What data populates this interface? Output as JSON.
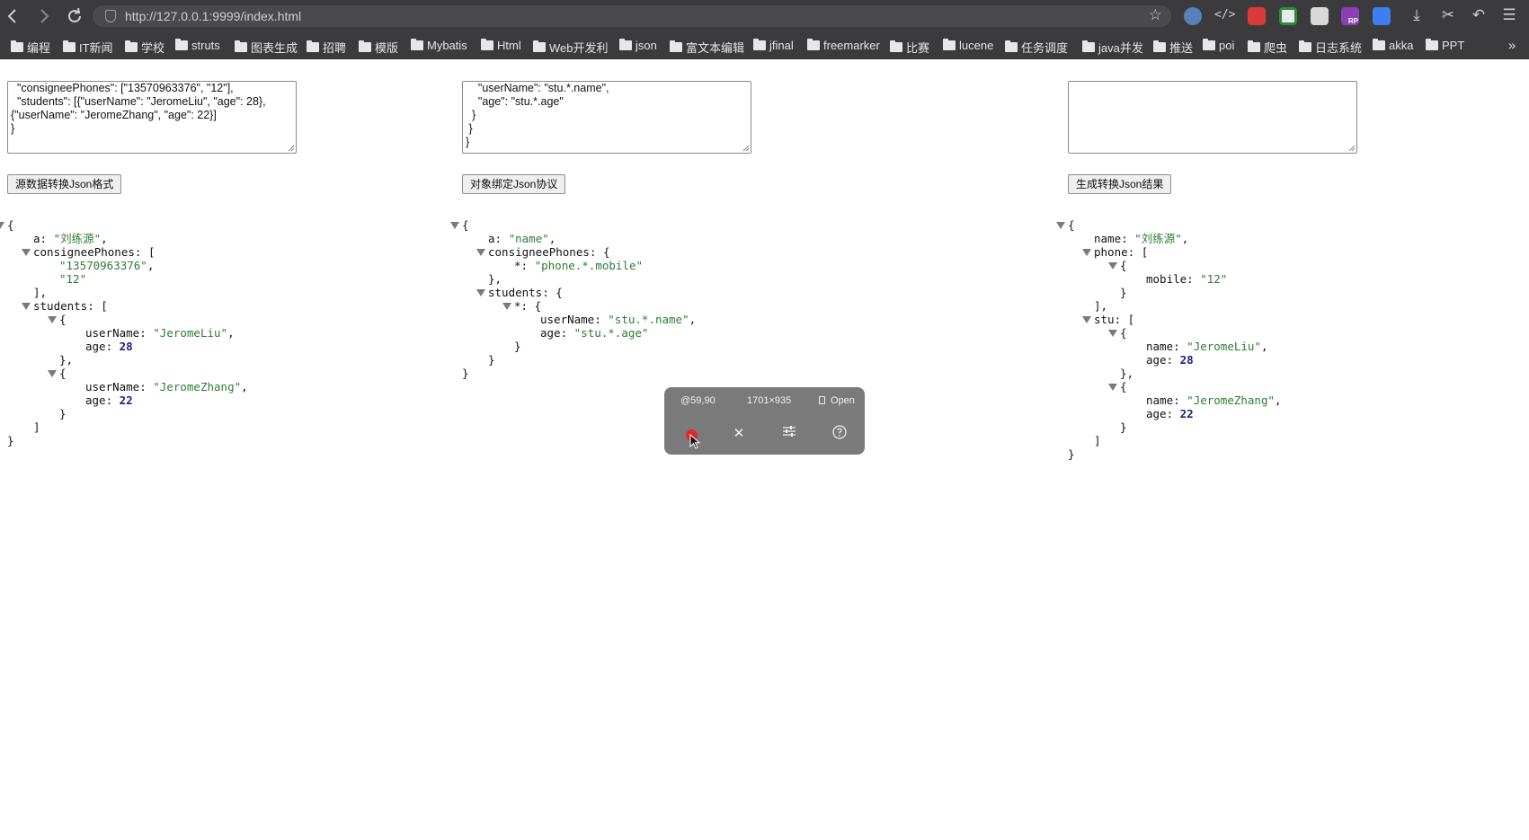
{
  "browser": {
    "url": "http://127.0.0.1:9999/index.html",
    "icons": [
      "back-icon",
      "forward-icon",
      "reload-icon",
      "shield-icon",
      "bookmark-star-icon"
    ],
    "extensions": [
      "translate-icon",
      "code-icon",
      "extension-red-icon",
      "extension-green-icon",
      "extension-gray-icon",
      "rp-icon",
      "pen-icon",
      "download-icon",
      "scissors-icon",
      "undo-icon",
      "menu-icon"
    ],
    "extension_badge": "RP",
    "bookmarks": [
      "编程",
      "IT新闻",
      "学校",
      "struts",
      "图表生成",
      "招聘",
      "模版",
      "Mybatis",
      "Html",
      "Web开发利",
      "json",
      "富文本编辑",
      "jfinal",
      "freemarker",
      "比赛",
      "lucene",
      "任务调度",
      "java并发",
      "推送",
      "poi",
      "爬虫",
      "日志系统",
      "akka",
      "PPT"
    ],
    "more_bookmarks": "»"
  },
  "panels": {
    "source": {
      "textarea": "  \"consigneePhones\": [\"13570963376\", \"12\"],\n  \"students\": [{\"userName\": \"JeromeLiu\", \"age\": 28},\n{\"userName\": \"JeromeZhang\", \"age\": 22}]\n}",
      "button": "源数据转换Json格式"
    },
    "protocol": {
      "textarea": "    \"userName\": \"stu.*.name\",\n    \"age\": \"stu.*.age\"\n  }\n }\n}",
      "button": "对象绑定Json协议"
    },
    "result": {
      "textarea": "",
      "button": "生成转换Json结果"
    }
  },
  "json_views": {
    "source": [
      {
        "indent": 0,
        "toggle": true,
        "parts": [
          [
            "p",
            "{"
          ]
        ]
      },
      {
        "indent": 1,
        "parts": [
          [
            "k",
            "a"
          ],
          [
            "p",
            ": "
          ],
          [
            "s",
            "\"刘练源\""
          ],
          [
            "p",
            ","
          ]
        ]
      },
      {
        "indent": 1,
        "toggle": true,
        "parts": [
          [
            "k",
            "consigneePhones"
          ],
          [
            "p",
            ": ["
          ]
        ]
      },
      {
        "indent": 2,
        "parts": [
          [
            "s",
            "\"13570963376\""
          ],
          [
            "p",
            ","
          ]
        ]
      },
      {
        "indent": 2,
        "parts": [
          [
            "s",
            "\"12\""
          ]
        ]
      },
      {
        "indent": 1,
        "parts": [
          [
            "p",
            "],"
          ]
        ]
      },
      {
        "indent": 1,
        "toggle": true,
        "parts": [
          [
            "k",
            "students"
          ],
          [
            "p",
            ": ["
          ]
        ]
      },
      {
        "indent": 2,
        "toggle": true,
        "parts": [
          [
            "p",
            "{"
          ]
        ]
      },
      {
        "indent": 3,
        "parts": [
          [
            "k",
            "userName"
          ],
          [
            "p",
            ": "
          ],
          [
            "s",
            "\"JeromeLiu\""
          ],
          [
            "p",
            ","
          ]
        ]
      },
      {
        "indent": 3,
        "parts": [
          [
            "k",
            "age"
          ],
          [
            "p",
            ": "
          ],
          [
            "n",
            "28"
          ]
        ]
      },
      {
        "indent": 2,
        "parts": [
          [
            "p",
            "},"
          ]
        ]
      },
      {
        "indent": 2,
        "toggle": true,
        "parts": [
          [
            "p",
            "{"
          ]
        ]
      },
      {
        "indent": 3,
        "parts": [
          [
            "k",
            "userName"
          ],
          [
            "p",
            ": "
          ],
          [
            "s",
            "\"JeromeZhang\""
          ],
          [
            "p",
            ","
          ]
        ]
      },
      {
        "indent": 3,
        "parts": [
          [
            "k",
            "age"
          ],
          [
            "p",
            ": "
          ],
          [
            "n",
            "22"
          ]
        ]
      },
      {
        "indent": 2,
        "parts": [
          [
            "p",
            "}"
          ]
        ]
      },
      {
        "indent": 1,
        "parts": [
          [
            "p",
            "]"
          ]
        ]
      },
      {
        "indent": 0,
        "parts": [
          [
            "p",
            "}"
          ]
        ]
      }
    ],
    "protocol": [
      {
        "indent": 0,
        "toggle": true,
        "parts": [
          [
            "p",
            "{"
          ]
        ]
      },
      {
        "indent": 1,
        "parts": [
          [
            "k",
            "a"
          ],
          [
            "p",
            ": "
          ],
          [
            "s",
            "\"name\""
          ],
          [
            "p",
            ","
          ]
        ]
      },
      {
        "indent": 1,
        "toggle": true,
        "parts": [
          [
            "k",
            "consigneePhones"
          ],
          [
            "p",
            ": {"
          ]
        ]
      },
      {
        "indent": 2,
        "parts": [
          [
            "k",
            "*"
          ],
          [
            "p",
            ": "
          ],
          [
            "s",
            "\"phone.*.mobile\""
          ]
        ]
      },
      {
        "indent": 1,
        "parts": [
          [
            "p",
            "},"
          ]
        ]
      },
      {
        "indent": 1,
        "toggle": true,
        "parts": [
          [
            "k",
            "students"
          ],
          [
            "p",
            ": {"
          ]
        ]
      },
      {
        "indent": 2,
        "toggle": true,
        "parts": [
          [
            "k",
            "*"
          ],
          [
            "p",
            ": {"
          ]
        ]
      },
      {
        "indent": 3,
        "parts": [
          [
            "k",
            "userName"
          ],
          [
            "p",
            ": "
          ],
          [
            "s",
            "\"stu.*.name\""
          ],
          [
            "p",
            ","
          ]
        ]
      },
      {
        "indent": 3,
        "parts": [
          [
            "k",
            "age"
          ],
          [
            "p",
            ": "
          ],
          [
            "s",
            "\"stu.*.age\""
          ]
        ]
      },
      {
        "indent": 2,
        "parts": [
          [
            "p",
            "}"
          ]
        ]
      },
      {
        "indent": 1,
        "parts": [
          [
            "p",
            "}"
          ]
        ]
      },
      {
        "indent": 0,
        "parts": [
          [
            "p",
            "}"
          ]
        ]
      }
    ],
    "result": [
      {
        "indent": 0,
        "toggle": true,
        "parts": [
          [
            "p",
            "{"
          ]
        ]
      },
      {
        "indent": 1,
        "parts": [
          [
            "k",
            "name"
          ],
          [
            "p",
            ": "
          ],
          [
            "s",
            "\"刘练源\""
          ],
          [
            "p",
            ","
          ]
        ]
      },
      {
        "indent": 1,
        "toggle": true,
        "parts": [
          [
            "k",
            "phone"
          ],
          [
            "p",
            ": ["
          ]
        ]
      },
      {
        "indent": 2,
        "toggle": true,
        "parts": [
          [
            "p",
            "{"
          ]
        ]
      },
      {
        "indent": 3,
        "parts": [
          [
            "k",
            "mobile"
          ],
          [
            "p",
            ": "
          ],
          [
            "s",
            "\"12\""
          ]
        ]
      },
      {
        "indent": 2,
        "parts": [
          [
            "p",
            "}"
          ]
        ]
      },
      {
        "indent": 1,
        "parts": [
          [
            "p",
            "],"
          ]
        ]
      },
      {
        "indent": 1,
        "toggle": true,
        "parts": [
          [
            "k",
            "stu"
          ],
          [
            "p",
            ": ["
          ]
        ]
      },
      {
        "indent": 2,
        "toggle": true,
        "parts": [
          [
            "p",
            "{"
          ]
        ]
      },
      {
        "indent": 3,
        "parts": [
          [
            "k",
            "name"
          ],
          [
            "p",
            ": "
          ],
          [
            "s",
            "\"JeromeLiu\""
          ],
          [
            "p",
            ","
          ]
        ]
      },
      {
        "indent": 3,
        "parts": [
          [
            "k",
            "age"
          ],
          [
            "p",
            ": "
          ],
          [
            "n",
            "28"
          ]
        ]
      },
      {
        "indent": 2,
        "parts": [
          [
            "p",
            "},"
          ]
        ]
      },
      {
        "indent": 2,
        "toggle": true,
        "parts": [
          [
            "p",
            "{"
          ]
        ]
      },
      {
        "indent": 3,
        "parts": [
          [
            "k",
            "name"
          ],
          [
            "p",
            ": "
          ],
          [
            "s",
            "\"JeromeZhang\""
          ],
          [
            "p",
            ","
          ]
        ]
      },
      {
        "indent": 3,
        "parts": [
          [
            "k",
            "age"
          ],
          [
            "p",
            ": "
          ],
          [
            "n",
            "22"
          ]
        ]
      },
      {
        "indent": 2,
        "parts": [
          [
            "p",
            "}"
          ]
        ]
      },
      {
        "indent": 1,
        "parts": [
          [
            "p",
            "]"
          ]
        ]
      },
      {
        "indent": 0,
        "parts": [
          [
            "p",
            "}"
          ]
        ]
      }
    ]
  },
  "overlay": {
    "position_text": "@59,90",
    "size_text": "1701×935",
    "open_label": "Open",
    "icons": [
      "record-icon",
      "close-icon",
      "settings-sliders-icon",
      "help-icon"
    ]
  },
  "colors": {
    "chrome": "#3b3b3d",
    "string": "#2e7d32",
    "number": "#1a237e",
    "overlay": "#7a7a7a",
    "record": "#e0282a"
  }
}
